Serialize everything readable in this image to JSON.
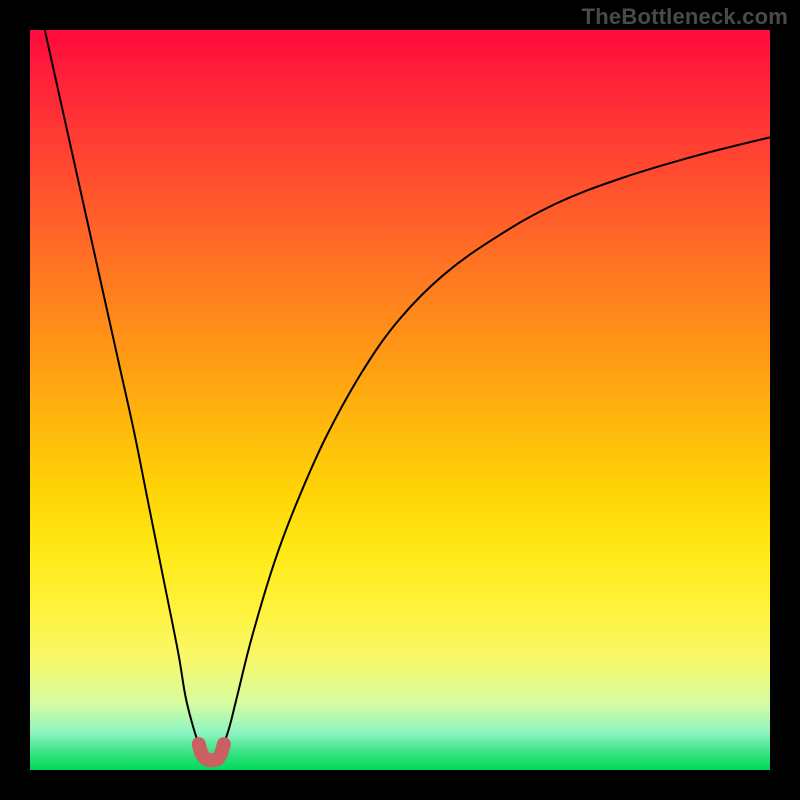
{
  "watermark": {
    "text": "TheBottleneck.com"
  },
  "chart_data": {
    "type": "line",
    "title": "",
    "xlabel": "",
    "ylabel": "",
    "xlim": [
      0,
      100
    ],
    "ylim": [
      0,
      100
    ],
    "grid": false,
    "legend": false,
    "series": [
      {
        "name": "left-arm",
        "stroke": "#000000",
        "stroke_width": 2,
        "x": [
          2,
          4,
          6,
          8,
          10,
          12,
          14,
          16,
          18,
          20,
          21,
          22,
          22.8
        ],
        "values": [
          100,
          91,
          82,
          73,
          64,
          55,
          46,
          36,
          26,
          16,
          10,
          6,
          3.5
        ]
      },
      {
        "name": "right-arm",
        "stroke": "#000000",
        "stroke_width": 2,
        "x": [
          26.2,
          27,
          28,
          30,
          33,
          36,
          40,
          45,
          50,
          56,
          63,
          71,
          80,
          90,
          100
        ],
        "values": [
          3.5,
          6,
          10,
          18,
          28,
          36,
          45,
          54,
          61,
          67,
          72,
          76.5,
          80,
          83,
          85.5
        ]
      },
      {
        "name": "trough",
        "stroke": "#cc5f62",
        "stroke_width": 14,
        "linecap": "round",
        "x": [
          22.8,
          23.2,
          23.8,
          24.5,
          25.3,
          25.8,
          26.2
        ],
        "values": [
          3.5,
          2.2,
          1.5,
          1.3,
          1.5,
          2.2,
          3.5
        ]
      }
    ]
  }
}
